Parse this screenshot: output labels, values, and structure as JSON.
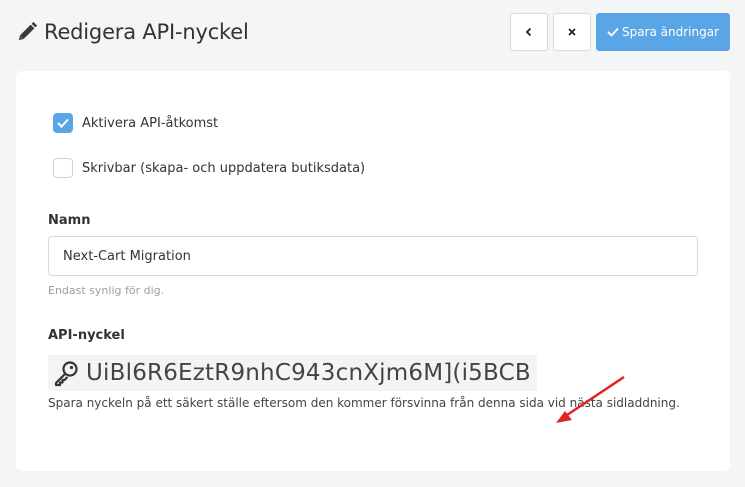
{
  "header": {
    "title": "Redigera API-nyckel",
    "save_label": "Spara ändringar"
  },
  "form": {
    "enable_api": {
      "label": "Aktivera API-åtkomst",
      "checked": true
    },
    "writable": {
      "label": "Skrivbar (skapa- och uppdatera butiksdata)",
      "checked": false
    },
    "name": {
      "label": "Namn",
      "value": "Next-Cart Migration",
      "hint": "Endast synlig för dig."
    },
    "api_key": {
      "label": "API-nyckel",
      "value": "UiBl6R6EztR9nhC943cnXjm6M](i5BCB",
      "note": "Spara nyckeln på ett säkert ställe eftersom den kommer försvinna från denna sida vid nästa sidladdning."
    }
  },
  "colors": {
    "accent": "#5aa5e6",
    "annotation_arrow": "#e02424",
    "background": "#f4f5f7"
  },
  "icons": {
    "title": "pencil-icon",
    "back": "chevron-left-icon",
    "close": "close-icon",
    "save": "checkmark-icon",
    "key": "key-icon"
  }
}
